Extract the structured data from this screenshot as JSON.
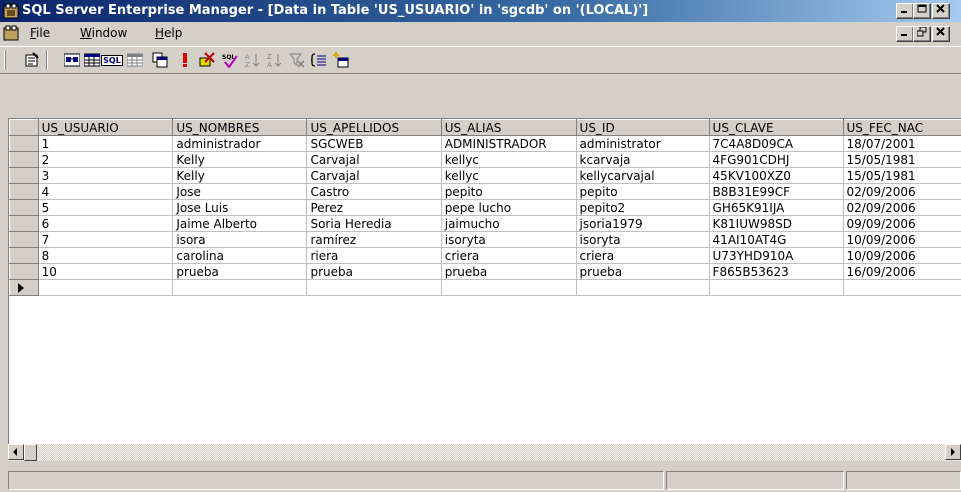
{
  "window": {
    "title": "SQL Server Enterprise Manager - [Data in Table 'US_USUARIO' in 'sgcdb' on '(LOCAL)']",
    "app_icon": "enterprise-manager-icon",
    "controls": [
      "minimize",
      "maximize",
      "close"
    ]
  },
  "menubar": {
    "items": [
      {
        "label": "File",
        "accel": "F",
        "rest": "ile"
      },
      {
        "label": "Window",
        "accel": "W",
        "rest": "indow"
      },
      {
        "label": "Help",
        "accel": "H",
        "rest": "elp"
      }
    ],
    "mdi_controls": [
      "minimize",
      "restore",
      "close"
    ]
  },
  "toolbar": {
    "buttons": [
      "properties-icon",
      "show-diagram-pane-icon",
      "show-grid-pane-icon",
      "show-sql-pane-icon",
      "show-results-pane-icon",
      "change-query-type-icon",
      "run-icon",
      "cancel-query-icon",
      "verify-sql-icon",
      "sort-ascending-icon",
      "sort-descending-icon",
      "remove-filter-icon",
      "group-by-icon",
      "add-table-icon"
    ],
    "sql_label": "SQL"
  },
  "grid": {
    "columns": [
      "US_USUARIO",
      "US_NOMBRES",
      "US_APELLIDOS",
      "US_ALIAS",
      "US_ID",
      "US_CLAVE",
      "US_FEC_NAC"
    ],
    "rows": [
      [
        "1",
        "administrador",
        "SGCWEB",
        "ADMINISTRADOR",
        "administrator",
        "7C4A8D09CA",
        "18/07/2001"
      ],
      [
        "2",
        "Kelly",
        "Carvajal",
        "kellyc",
        "kcarvaja",
        "4FG901CDHJ",
        "15/05/1981"
      ],
      [
        "3",
        "Kelly",
        "Carvajal",
        "kellyc",
        "kellycarvajal",
        "45KV100XZ0",
        "15/05/1981"
      ],
      [
        "4",
        "Jose",
        "Castro",
        "pepito",
        "pepito",
        "B8B31E99CF",
        "02/09/2006"
      ],
      [
        "5",
        "Jose Luis",
        "Perez",
        "pepe lucho",
        "pepito2",
        "GH65K91IJA",
        "02/09/2006"
      ],
      [
        "6",
        "Jaime Alberto",
        "Soria Heredia",
        "jaimucho",
        "jsoria1979",
        "K81IUW98SD",
        "09/09/2006"
      ],
      [
        "7",
        "isora",
        "ramírez",
        "isoryta",
        "isoryta",
        "41AI10AT4G",
        "10/09/2006"
      ],
      [
        "8",
        "carolina",
        "riera",
        "criera",
        "criera",
        "U73YHD910A",
        "10/09/2006"
      ],
      [
        "10",
        "prueba",
        "prueba",
        "prueba",
        "prueba",
        "F865B53623",
        "16/09/2006"
      ]
    ],
    "new_row_indicator": "current-row-arrow-icon"
  },
  "statusbar": {
    "panels": [
      "",
      "",
      ""
    ]
  }
}
